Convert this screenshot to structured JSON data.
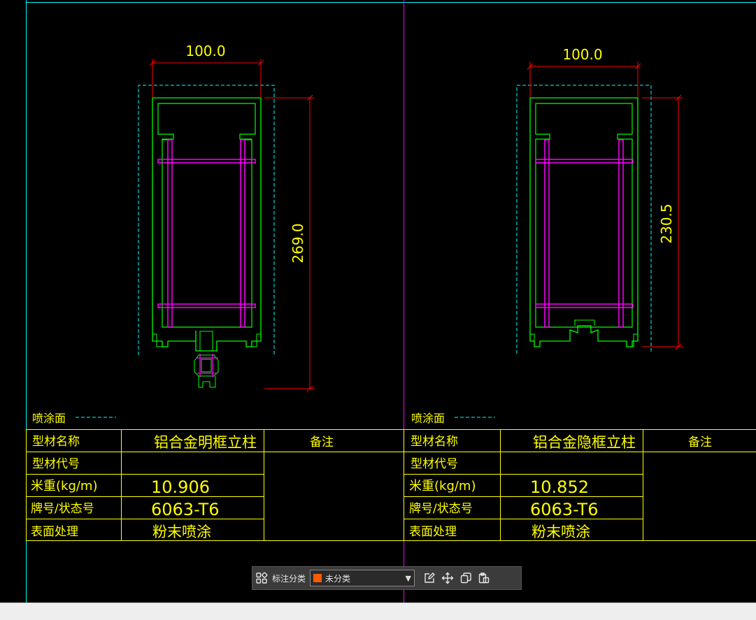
{
  "drawing": {
    "left": {
      "dim_width": "100.0",
      "dim_height": "269.0",
      "coating_label": "喷涂面",
      "table": {
        "name_label": "型材名称",
        "name_value": "铝合金明框立柱",
        "remark_label": "备注",
        "code_label": "型材代号",
        "code_value": "",
        "weight_label": "米重(kg/m)",
        "weight_value": "10.906",
        "grade_label": "牌号/状态号",
        "grade_value": "6063-T6",
        "surface_label": "表面处理",
        "surface_value": "粉末喷涂"
      }
    },
    "right": {
      "dim_width": "100.0",
      "dim_height": "230.5",
      "coating_label": "喷涂面",
      "table": {
        "name_label": "型材名称",
        "name_value": "铝合金隐框立柱",
        "remark_label": "备注",
        "code_label": "型材代号",
        "code_value": "",
        "weight_label": "米重(kg/m)",
        "weight_value": "10.852",
        "grade_label": "牌号/状态号",
        "grade_value": "6063-T6",
        "surface_label": "表面处理",
        "surface_value": "粉末喷涂"
      }
    },
    "colors": {
      "background": "#000000",
      "profile": "#00ff00",
      "reinforcement": "#ff00ff",
      "dimension": "#ff0000",
      "text": "#ffff00",
      "coating_line": "#00ffff"
    }
  },
  "toolbar": {
    "category_label": "标注分类",
    "category_value": "未分类",
    "category_color": "#ff5a00"
  }
}
